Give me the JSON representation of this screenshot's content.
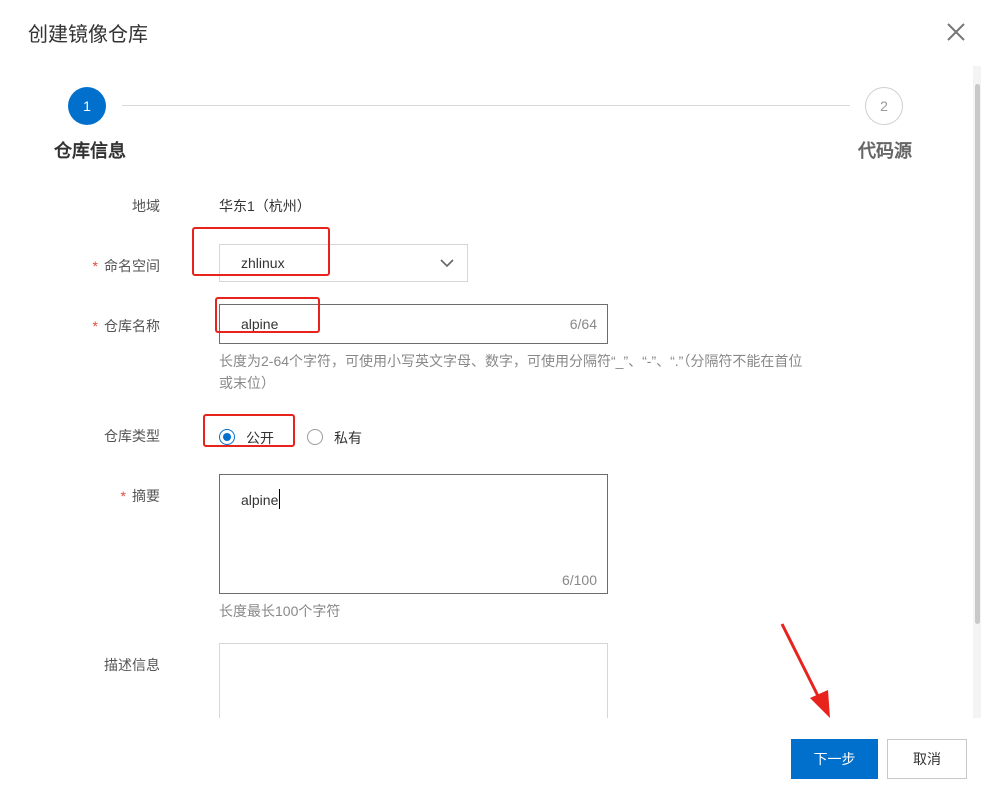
{
  "dialog": {
    "title": "创建镜像仓库"
  },
  "steps": [
    {
      "number": "1",
      "label": "仓库信息"
    },
    {
      "number": "2",
      "label": "代码源"
    }
  ],
  "form": {
    "region": {
      "label": "地域",
      "value": "华东1（杭州）"
    },
    "namespace": {
      "label": "命名空间",
      "value": "zhlinux"
    },
    "repo_name": {
      "label": "仓库名称",
      "value": "alpine",
      "count": "6/64",
      "hint_line1": "长度为2-64个字符，可使用小写英文字母、数字，可使用分隔符“_”、“-”、“.”（分隔符不能在首位",
      "hint_line2": "或末位）"
    },
    "repo_type": {
      "label": "仓库类型",
      "options": [
        "公开",
        "私有"
      ],
      "selected": "公开"
    },
    "summary": {
      "label": "摘要",
      "value": "alpine",
      "count": "6/100",
      "hint": "长度最长100个字符"
    },
    "description": {
      "label": "描述信息",
      "value": ""
    },
    "required_mark": "*"
  },
  "buttons": {
    "next": "下一步",
    "cancel": "取消"
  },
  "colors": {
    "primary": "#0070cc",
    "annotation": "#e8231c",
    "required": "#e24b3b"
  },
  "icons": [
    "close-icon",
    "chevron-down-icon",
    "annotation-arrow"
  ]
}
